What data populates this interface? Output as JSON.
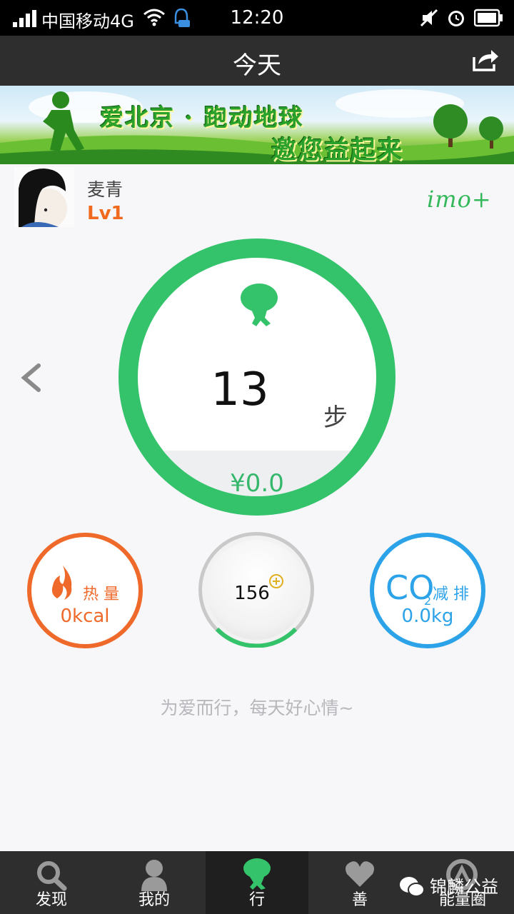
{
  "status_bar": {
    "carrier": "中国移动4G",
    "time": "12:20"
  },
  "header": {
    "title": "今天"
  },
  "banner": {
    "line1": "爱北京 · 跑动地球",
    "line2": "邀您益起来"
  },
  "profile": {
    "name": "麦青",
    "level": "Lv1",
    "brand": "imo+"
  },
  "steps": {
    "count": "13",
    "unit": "步",
    "money": "¥0.0"
  },
  "calorie": {
    "label": "热 量",
    "value": "0kcal"
  },
  "energy": {
    "value": "156"
  },
  "co2": {
    "label_main": "CO",
    "label_sub": "2",
    "label_text": "减 排",
    "value": "0.0kg"
  },
  "motto": "为爱而行，每天好心情~",
  "nav": {
    "items": [
      {
        "label": "发现"
      },
      {
        "label": "我的"
      },
      {
        "label": "行"
      },
      {
        "label": "善"
      },
      {
        "label": "能量圈"
      }
    ]
  },
  "watermark": "锦麟公益",
  "colors": {
    "green": "#34c36b",
    "orange": "#ef6a2a",
    "blue": "#2ca3e8"
  }
}
